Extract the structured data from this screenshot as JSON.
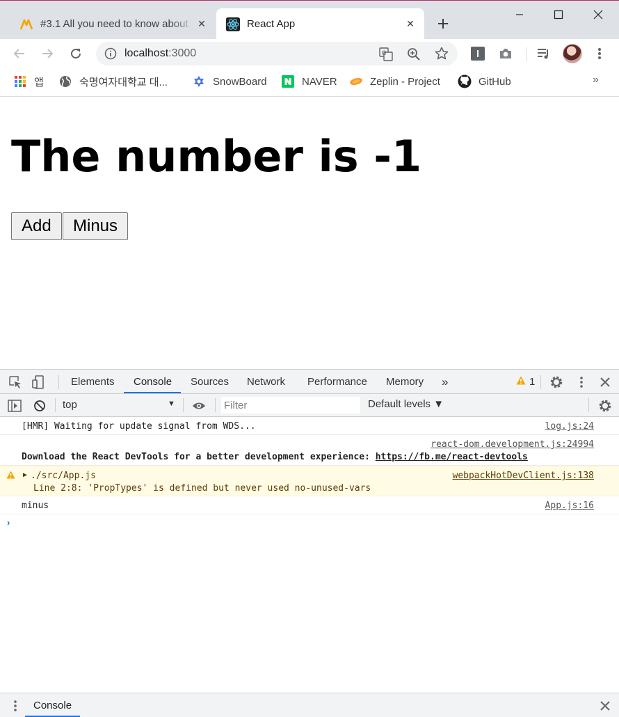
{
  "browser": {
    "tabs": [
      {
        "title": "#3.1 All you need to know about",
        "active": false
      },
      {
        "title": "React App",
        "active": true
      }
    ],
    "url_host": "localhost",
    "url_port": ":3000",
    "bookmarks": [
      {
        "label": "앱",
        "icon": "apps-grid-icon"
      },
      {
        "label": "숙명여자대학교 대...",
        "icon": "globe-icon"
      },
      {
        "label": "SnowBoard",
        "icon": "snowflake-icon"
      },
      {
        "label": "NAVER",
        "icon": "naver-icon"
      },
      {
        "label": "Zeplin - Project",
        "icon": "zeplin-icon"
      },
      {
        "label": "GitHub",
        "icon": "github-icon"
      }
    ],
    "bookmarks_more": "»"
  },
  "page": {
    "heading": "The number is -1",
    "buttons": {
      "add": "Add",
      "minus": "Minus"
    }
  },
  "devtools": {
    "tabs": [
      "Elements",
      "Console",
      "Sources",
      "Network",
      "Performance",
      "Memory"
    ],
    "more_tabs": "»",
    "active_tab": "Console",
    "warning_count": "1",
    "context": "top",
    "filter_placeholder": "Filter",
    "levels": "Default levels ▼",
    "messages": [
      {
        "text": "[HMR] Waiting for update signal from WDS...",
        "source": "log.js:24"
      },
      {
        "source": "react-dom.development.js:24994",
        "text": "Download the React DevTools for a better development experience: ",
        "link": "https://fb.me/react-devtools"
      },
      {
        "type": "warning",
        "file": "./src/App.js",
        "detail": "Line 2:8:  'PropTypes' is defined but never used  no-unused-vars",
        "source": "webpackHotDevClient.js:138"
      },
      {
        "text": "minus",
        "source": "App.js:16"
      }
    ],
    "prompt": "›",
    "drawer_tab": "Console"
  },
  "colors": {
    "accent": "#1a73e8",
    "warning_bg": "#fffbe5",
    "warning_icon": "#f2a600",
    "react": "#61dafb",
    "naver": "#03c75a"
  }
}
